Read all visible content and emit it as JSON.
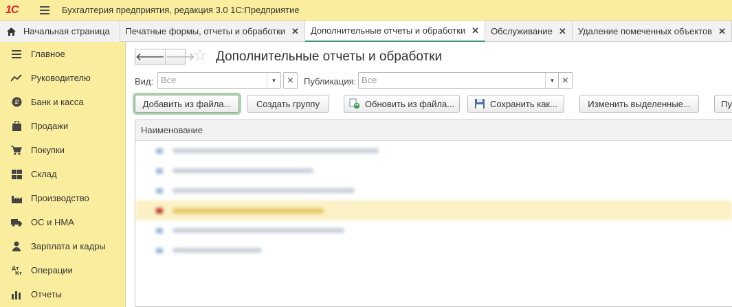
{
  "app": {
    "logo": "1С",
    "title": "Бухгалтерия предприятия, редакция 3.0 1С:Предприятие"
  },
  "tabs": [
    {
      "label": "Начальная страница",
      "icon": "home-icon"
    },
    {
      "label": "Печатные формы, отчеты и обработки"
    },
    {
      "label": "Дополнительные отчеты и обработки",
      "active": true
    },
    {
      "label": "Обслуживание"
    },
    {
      "label": "Удаление помеченных объектов"
    }
  ],
  "sidebar": {
    "items": [
      {
        "label": "Главное",
        "icon": "menu-lines-icon"
      },
      {
        "label": "Руководителю",
        "icon": "trend-chart-icon"
      },
      {
        "label": "Банк и касса",
        "icon": "ruble-coin-icon"
      },
      {
        "label": "Продажи",
        "icon": "shopping-bag-icon"
      },
      {
        "label": "Покупки",
        "icon": "shopping-cart-icon"
      },
      {
        "label": "Склад",
        "icon": "warehouse-grid-icon"
      },
      {
        "label": "Производство",
        "icon": "factory-icon"
      },
      {
        "label": "ОС и НМА",
        "icon": "truck-icon"
      },
      {
        "label": "Зарплата и кадры",
        "icon": "person-icon"
      },
      {
        "label": "Операции",
        "icon": "dt-kt-icon"
      },
      {
        "label": "Отчеты",
        "icon": "report-chart-icon"
      }
    ]
  },
  "main": {
    "title": "Дополнительные отчеты и обработки",
    "filters": {
      "kind_label": "Вид:",
      "kind_placeholder": "Все",
      "publication_label": "Публикация:",
      "publication_placeholder": "Все"
    },
    "toolbar": {
      "add_from_file": "Добавить из файла...",
      "create_group": "Создать группу",
      "update_from_file": "Обновить из файла...",
      "save_as": "Сохранить как...",
      "change_selected": "Изменить выделенные...",
      "next_partial": "Пу"
    },
    "table": {
      "column_header": "Наименование"
    }
  },
  "colors": {
    "sidebar_bg": "#fbed9e",
    "active_tab_underline": "#3c9a72",
    "default_button_glow": "#a8d3a8",
    "selected_row": "#fbf1c5"
  }
}
